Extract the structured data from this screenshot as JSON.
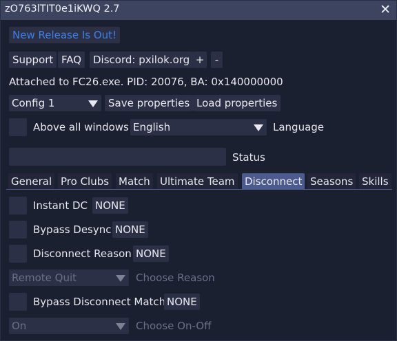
{
  "window": {
    "title": "zO763lTIT0e1iKWQ 2.7",
    "close_glyph": "✕"
  },
  "release": {
    "label": "New Release Is Out!"
  },
  "links": {
    "support": "Support",
    "faq": "FAQ",
    "discord": "Discord: pxilok.org",
    "plus": "+",
    "minus": "-"
  },
  "attached_text": "Attached to FC26.exe.  PID: 20076, BA: 0x140000000",
  "config": {
    "selected": "Config 1",
    "save": "Save properties",
    "load": "Load properties"
  },
  "above_all": {
    "label": "Above all windows",
    "language_selected": "English",
    "language_label": "Language"
  },
  "status": {
    "value": "",
    "label": "Status"
  },
  "tabs": [
    {
      "label": "General",
      "active": false
    },
    {
      "label": "Pro Clubs",
      "active": false
    },
    {
      "label": "Match",
      "active": false
    },
    {
      "label": "Ultimate Team",
      "active": false
    },
    {
      "label": "Disconnect",
      "active": true
    },
    {
      "label": "Seasons",
      "active": false
    },
    {
      "label": "Skills",
      "active": false
    }
  ],
  "disconnect": {
    "instant_dc": {
      "label": "Instant DC",
      "key": "NONE"
    },
    "bypass_desync": {
      "label": "Bypass Desync",
      "key": "NONE"
    },
    "reason": {
      "label": "Disconnect Reason",
      "key": "NONE"
    },
    "reason_combo": {
      "selected": "Remote Quit",
      "label": "Choose Reason"
    },
    "bypass_match": {
      "label": "Bypass Disconnect Match",
      "key": "NONE"
    },
    "onoff_combo": {
      "selected": "On",
      "label": "Choose On-Off"
    }
  },
  "colors": {
    "background": "#1b2030",
    "titlebar": "#3c4460",
    "widget": "#2b3046",
    "accent": "#4d5a8e",
    "link": "#3f7fe6",
    "disabled_text": "#6b7086"
  },
  "icons": {
    "dropdown": "triangle-down-icon",
    "close": "close-icon"
  }
}
